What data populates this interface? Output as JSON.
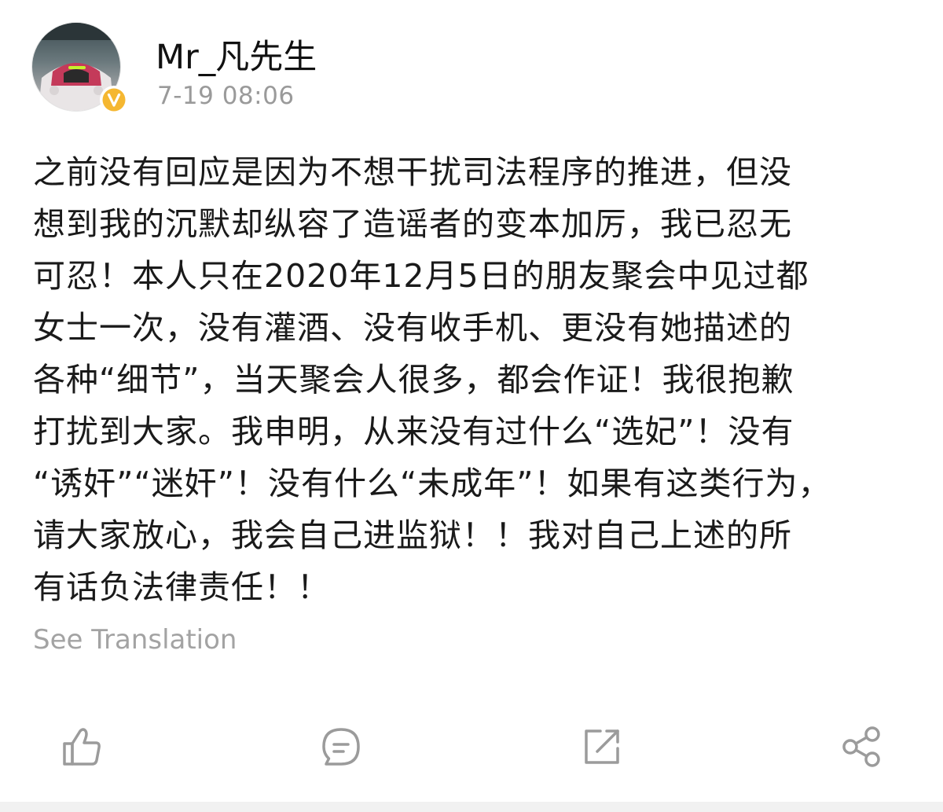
{
  "post": {
    "username": "Mr_凡先生",
    "timestamp": "7-19 08:06",
    "content_lines": [
      "之前没有回应是因为不想干扰司法程序的推进，但没",
      "想到我的沉默却纵容了造谣者的变本加厉，我已忍无",
      "可忍！本人只在2020年12月5日的朋友聚会中见过都",
      "女士一次，没有灌酒、没有收手机、更没有她描述的",
      "各种“细节”，当天聚会人很多，都会作证！我很抱歉",
      "打扰到大家。我申明，从来没有过什么“选妃”！没有",
      "“诱奸”“迷奸”！没有什么“未成年”！如果有这类行为，",
      "请大家放心，我会自己进监狱！！我对自己上述的所",
      "有话负法律责任！！"
    ],
    "see_translation": "See Translation"
  },
  "actions": {
    "like_icon": "thumbs-up-icon",
    "comment_icon": "comment-bubble-icon",
    "repost_icon": "repost-arrow-icon",
    "share_icon": "share-nodes-icon"
  },
  "colors": {
    "text_primary": "#1a1a1a",
    "text_secondary": "#9a9a9a",
    "verified_badge": "#f5b731",
    "icon_stroke": "#9b9b9b"
  }
}
